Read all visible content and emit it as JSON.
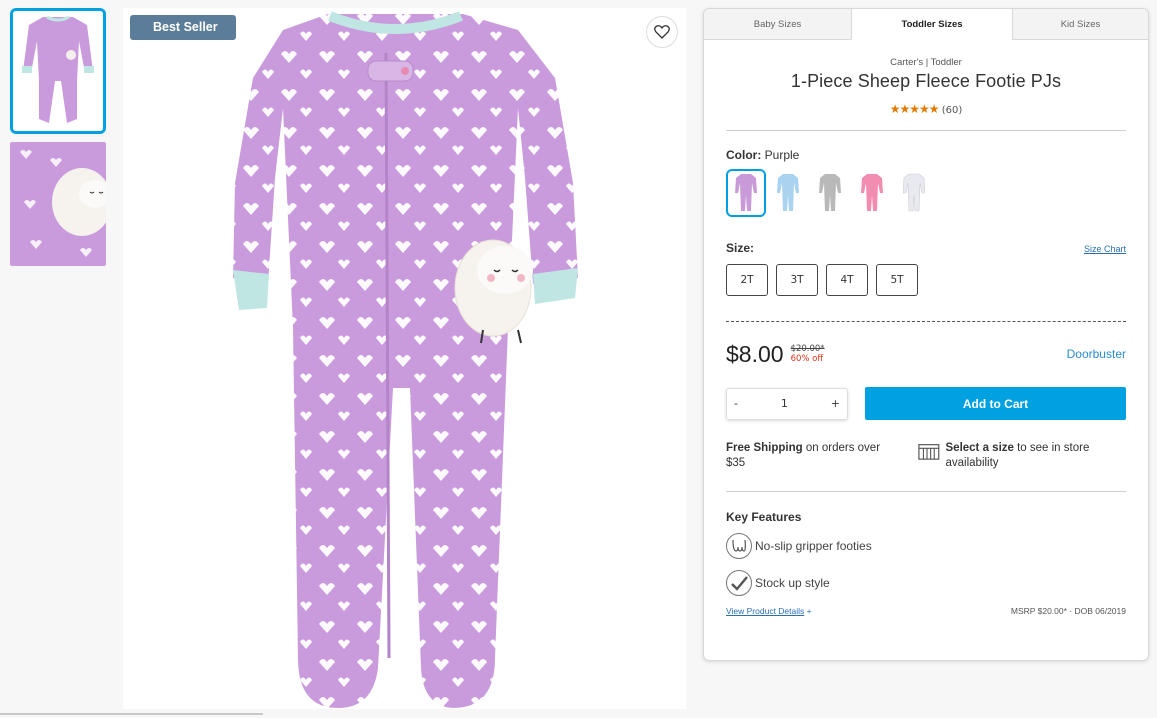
{
  "product": {
    "badge": "Best Seller",
    "brand": "Carter's | Toddler",
    "title": "1-Piece Sheep Fleece Footie PJs",
    "stars": "★★★★★",
    "review_count": "(60)",
    "rating_value": 5
  },
  "tabs": [
    {
      "label": "Baby Sizes"
    },
    {
      "label": "Toddler Sizes"
    },
    {
      "label": "Kid Sizes"
    }
  ],
  "color": {
    "label": "Color:",
    "selected": "Purple",
    "swatch_colors": [
      "#c89ad8",
      "#a9d3ee",
      "#b9b9b9",
      "#f28cb0",
      "#e9e9f2"
    ]
  },
  "size": {
    "label": "Size:",
    "chart_link": "Size Chart",
    "options": [
      "2T",
      "3T",
      "4T",
      "5T"
    ]
  },
  "pricing": {
    "price": "$8.00",
    "original": "$20.00*",
    "discount": "60% off",
    "promo": "Doorbuster"
  },
  "cart": {
    "minus": "-",
    "quantity": "1",
    "plus": "+",
    "add_label": "Add to Cart"
  },
  "shipping": {
    "bold": "Free Shipping",
    "text": "on orders over $35"
  },
  "store": {
    "bold": "Select a size",
    "text": "to see in store availability"
  },
  "features": {
    "title": "Key Features",
    "items": [
      "No-slip gripper footies",
      "Stock up style"
    ]
  },
  "footer": {
    "details_link": "View Product Details",
    "details_plus": "+",
    "msrp": "MSRP $20.00* · DOB 06/2019"
  },
  "colors": {
    "accent": "#00a1e0",
    "badge_bg": "#5b7d99",
    "star": "#e07b00",
    "sale_red": "#e0321c",
    "link": "#2a6fb5",
    "pj_purple": "#c99bdd",
    "cuff_mint": "#bfe6e3"
  }
}
